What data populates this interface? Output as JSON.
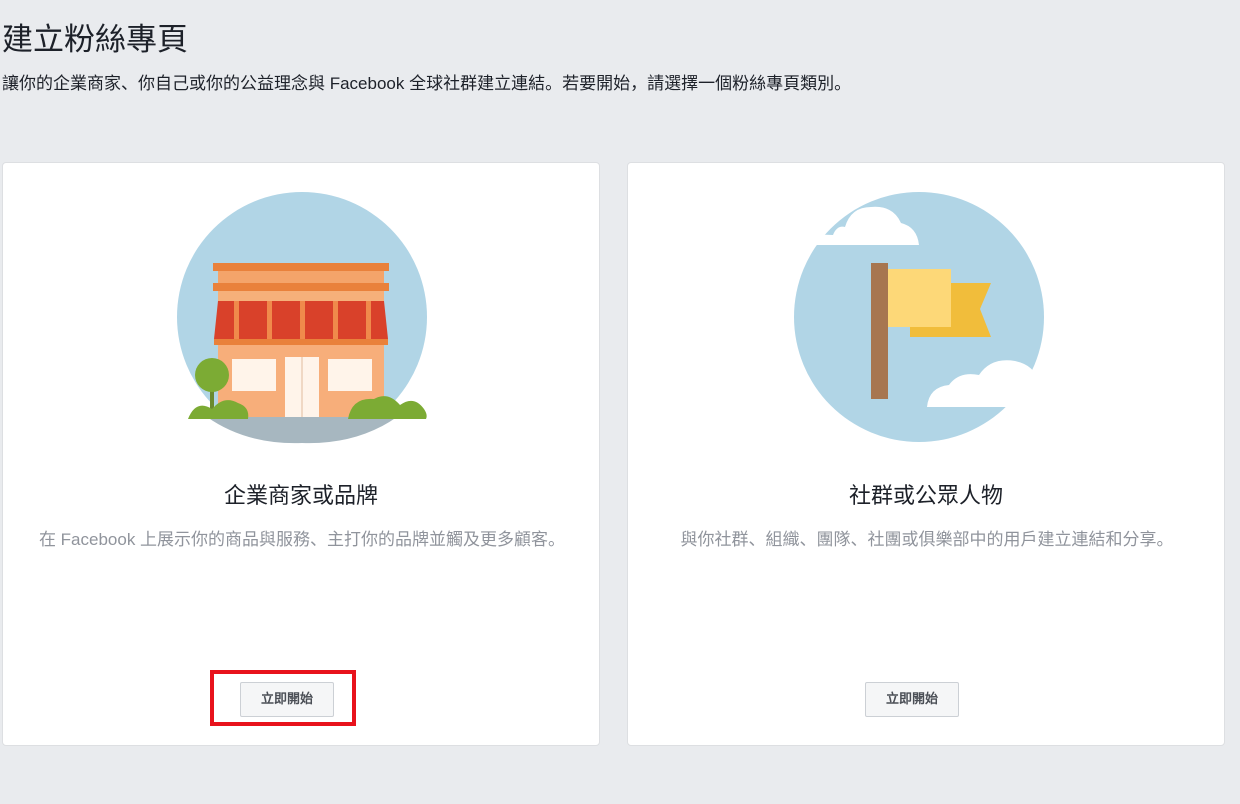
{
  "header": {
    "title": "建立粉絲專頁",
    "subtitle": "讓你的企業商家、你自己或你的公益理念與 Facebook 全球社群建立連結。若要開始，請選擇一個粉絲專頁類別。"
  },
  "cards": [
    {
      "illustration_icon": "storefront-icon",
      "title": "企業商家或品牌",
      "description": "在 Facebook 上展示你的商品與服務、主打你的品牌並觸及更多顧客。",
      "button_label": "立即開始"
    },
    {
      "illustration_icon": "flag-icon",
      "title": "社群或公眾人物",
      "description": "與你社群、組織、團隊、社團或俱樂部中的用戶建立連結和分享。",
      "button_label": "立即開始"
    }
  ],
  "colors": {
    "page_background": "#e9ebee",
    "card_background": "#ffffff",
    "highlight": "#e8121c",
    "sky_circle": "#b1d5e6"
  }
}
